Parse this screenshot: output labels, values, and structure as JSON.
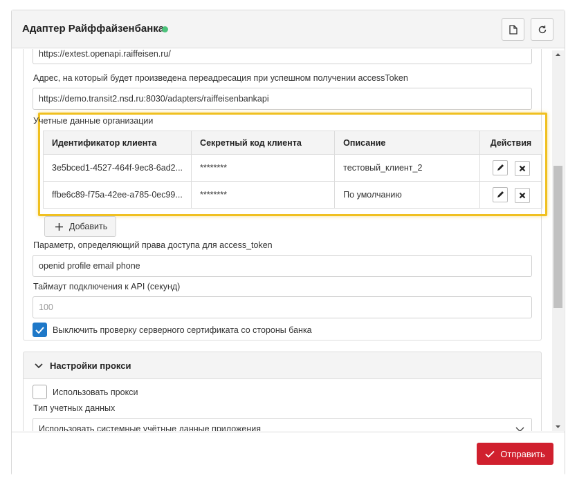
{
  "header": {
    "title": "Адаптер Райффайзенбанка",
    "status_color": "#4cc27b",
    "icons": [
      "file-icon",
      "refresh-icon"
    ]
  },
  "fields": {
    "base_url": {
      "value": "https://extest.openapi.raiffeisen.ru/"
    },
    "redirect": {
      "label": "Адрес, на который будет произведена переадресация при успешном получении accessToken",
      "value": "https://demo.transit2.nsd.ru:8030/adapters/raiffeisenbankapi"
    },
    "scope": {
      "label": "Параметр, определяющий права доступа для access_token",
      "value": "openid profile email phone"
    },
    "timeout": {
      "label": "Таймаут подключения к API (секунд)",
      "placeholder": "100"
    },
    "disable_cert": {
      "label": "Выключить проверку серверного сертификата со стороны банка",
      "checked": true
    }
  },
  "credentials": {
    "label": "Учетные данные организации",
    "columns": [
      "Идентификатор клиента",
      "Секретный код клиента",
      "Описание",
      "Действия"
    ],
    "rows": [
      {
        "client_id": "3e5bced1-4527-464f-9ec8-6ad2...",
        "secret": "********",
        "description": "тестовый_клиент_2"
      },
      {
        "client_id": "ffbe6c89-f75a-42ee-a785-0ec99...",
        "secret": "********",
        "description": "По умолчанию"
      }
    ],
    "add_label": "Добавить",
    "highlight_color": "#f0c020"
  },
  "proxy": {
    "title": "Настройки прокси",
    "use_proxy": {
      "label": "Использовать прокси",
      "checked": false
    },
    "cred_type": {
      "label": "Тип учетных данных",
      "value": "Использовать системные учётные данные приложения"
    }
  },
  "footer": {
    "submit_label": "Отправить",
    "submit_color": "#d0202e"
  }
}
